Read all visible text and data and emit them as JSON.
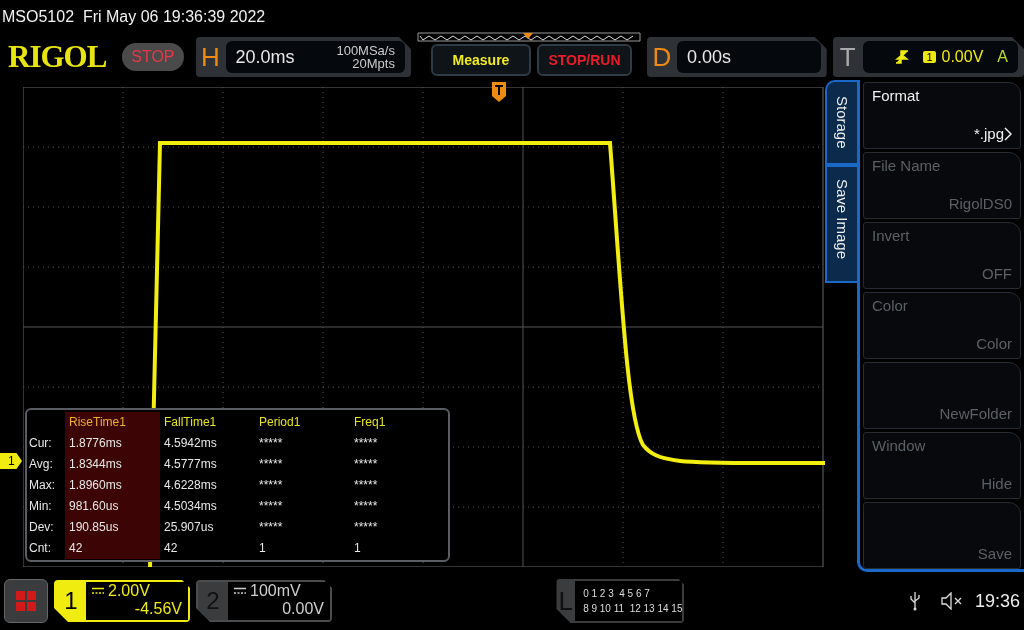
{
  "title": "MSO5102  Fri May 06 19:36:39 2022",
  "logo": "RIGOL",
  "run_state": "STOP",
  "horizontal": {
    "letter": "H",
    "timebase": "20.0ms",
    "sample_rate": "100MSa/s",
    "memory_depth": "20Mpts"
  },
  "buttons": [
    {
      "label": "Measure",
      "kind": "measure"
    },
    {
      "label": "STOP/RUN",
      "kind": "stoprun"
    }
  ],
  "delay": {
    "letter": "D",
    "value": "0.00s"
  },
  "trigger": {
    "letter": "T",
    "source": "1",
    "level": "0.00V",
    "mode": "A"
  },
  "channel_marker": "1",
  "measurements": {
    "columns": [
      {
        "label": "RiseTime1",
        "selected": true
      },
      {
        "label": "FallTime1",
        "selected": false
      },
      {
        "label": "Period1",
        "selected": false
      },
      {
        "label": "Freq1",
        "selected": false
      }
    ],
    "rows": [
      {
        "label": "Cur:",
        "values": [
          "1.8776ms",
          "4.5942ms",
          "*****",
          "*****"
        ]
      },
      {
        "label": "Avg:",
        "values": [
          "1.8344ms",
          "4.5777ms",
          "*****",
          "*****"
        ]
      },
      {
        "label": "Max:",
        "values": [
          "1.8960ms",
          "4.6228ms",
          "*****",
          "*****"
        ]
      },
      {
        "label": "Min:",
        "values": [
          "981.60us",
          "4.5034ms",
          "*****",
          "*****"
        ]
      },
      {
        "label": "Dev:",
        "values": [
          "190.85us",
          "25.907us",
          "*****",
          "*****"
        ]
      },
      {
        "label": "Cnt:",
        "values": [
          "42",
          "42",
          "1",
          "1"
        ]
      }
    ]
  },
  "side_tabs": [
    "Storage",
    "Save Image"
  ],
  "menu": [
    {
      "label": "Format",
      "value": "*.jpg",
      "disabled": false,
      "submenu": true
    },
    {
      "label": "File Name",
      "value": "RigolDS0",
      "disabled": true,
      "submenu": false
    },
    {
      "label": "Invert",
      "value": "OFF",
      "disabled": true,
      "submenu": false
    },
    {
      "label": "Color",
      "value": "Color",
      "disabled": true,
      "submenu": false
    },
    {
      "value": "NewFolder",
      "disabled": true,
      "submenu": false
    },
    {
      "label": "Window",
      "value": "Hide",
      "disabled": true,
      "submenu": false
    },
    {
      "value": "Save",
      "disabled": true,
      "submenu": false
    }
  ],
  "channels": [
    {
      "number": "1",
      "scale": "2.00V",
      "offset": "-4.56V",
      "on": true
    },
    {
      "number": "2",
      "scale": "100mV",
      "offset": "0.00V",
      "on": false
    }
  ],
  "logic": {
    "letter": "L",
    "rows": [
      "0 1 2 3  4 5 6 7",
      "8 9 10 11  12 13 14 15"
    ]
  },
  "status": {
    "time": "19:36"
  }
}
